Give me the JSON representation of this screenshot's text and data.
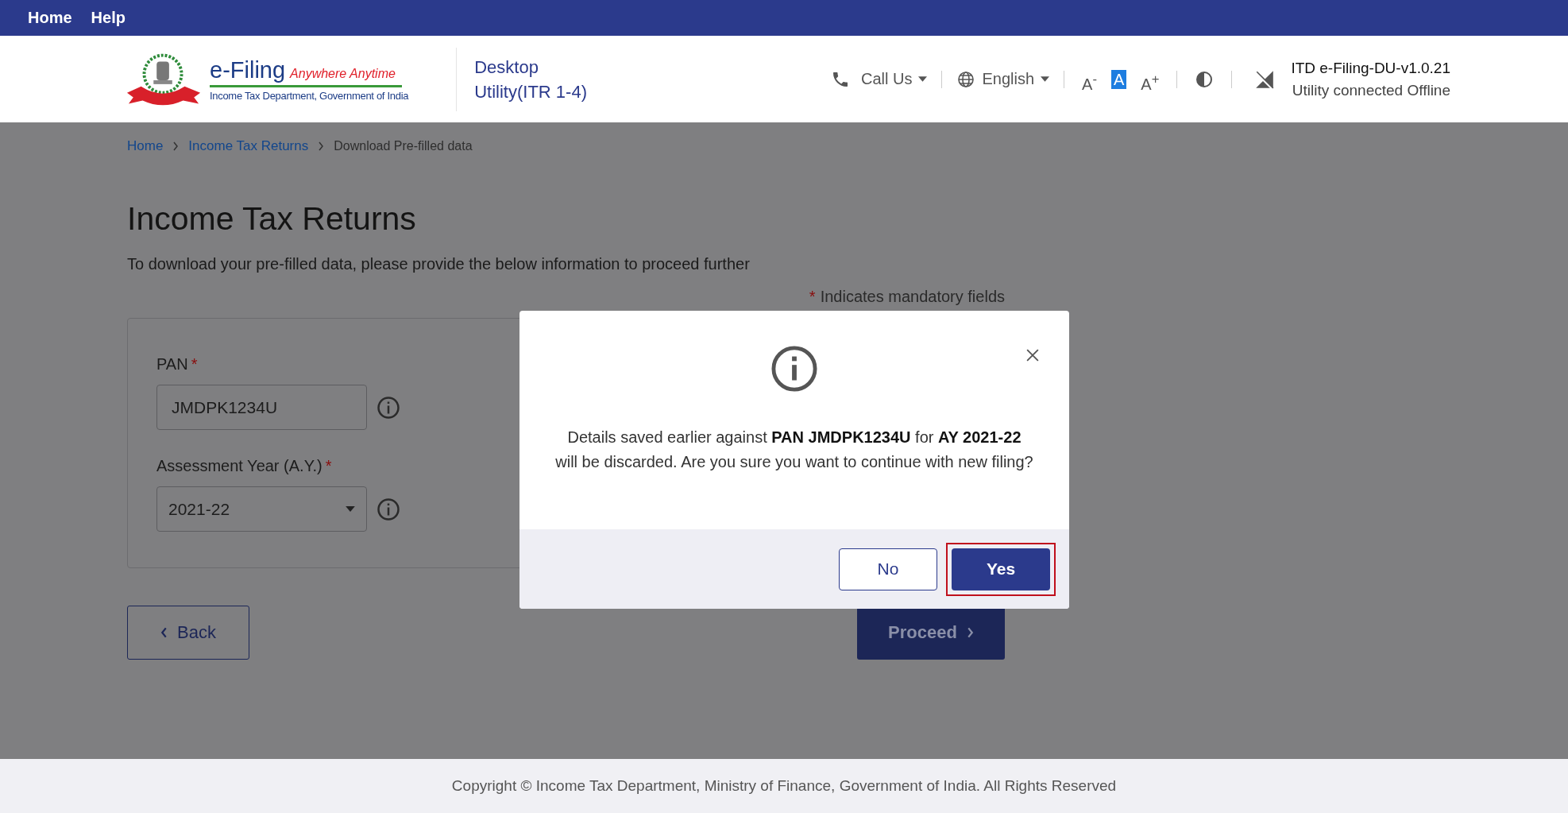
{
  "top_nav": [
    {
      "label": "Home"
    },
    {
      "label": "Help"
    }
  ],
  "header": {
    "logo": {
      "title": "e-Filing",
      "tagline": "Anywhere Anytime",
      "subtitle": "Income Tax Department, Government of India"
    },
    "app_name": [
      "Desktop",
      "Utility(ITR 1-4)"
    ],
    "call_us": "Call Us",
    "language": "English",
    "font_sizes": [
      {
        "label": "A$^{-}$",
        "selected": false
      },
      {
        "label": "A",
        "selected": true
      },
      {
        "label": "A$^{+}$",
        "selected": false
      }
    ],
    "version": "ITD e-Filing-DU-v1.0.21",
    "status": "Utility connected Offline"
  },
  "breadcrumb": [
    {
      "label": "Home",
      "kind": "link"
    },
    {
      "label": "Income Tax Returns",
      "kind": "link"
    },
    {
      "label": "Download Pre-filled data",
      "kind": "current"
    }
  ],
  "page": {
    "title": "Income Tax Returns",
    "subtitle": "To download your pre-filled data, please provide the below information to proceed further",
    "mandatory_note": {
      "mark": "*",
      "text": "Indicates mandatory fields"
    }
  },
  "form": {
    "required_mark": "*",
    "fields": [
      {
        "label": "PAN",
        "required": true,
        "kind": "text",
        "value": "JMDPK1234U"
      },
      {
        "label": "Assessment Year (A.Y.)",
        "required": true,
        "kind": "select",
        "value": "2021-22"
      }
    ]
  },
  "actions": {
    "back": "Back",
    "proceed": "Proceed"
  },
  "dialog": {
    "message": "Details saved earlier against **PAN JMDPK1234U** for **AY 2021-22**\nwill be discarded. Are you sure you want to continue with new filing?",
    "buttons": [
      {
        "label": "No",
        "kind": "secondary",
        "highlighted": false
      },
      {
        "label": "Yes",
        "kind": "primary",
        "highlighted": true
      }
    ]
  },
  "footer": {
    "copyright": "Copyright © Income Tax Department, Ministry of Finance, Government of India. All Rights Reserved"
  }
}
